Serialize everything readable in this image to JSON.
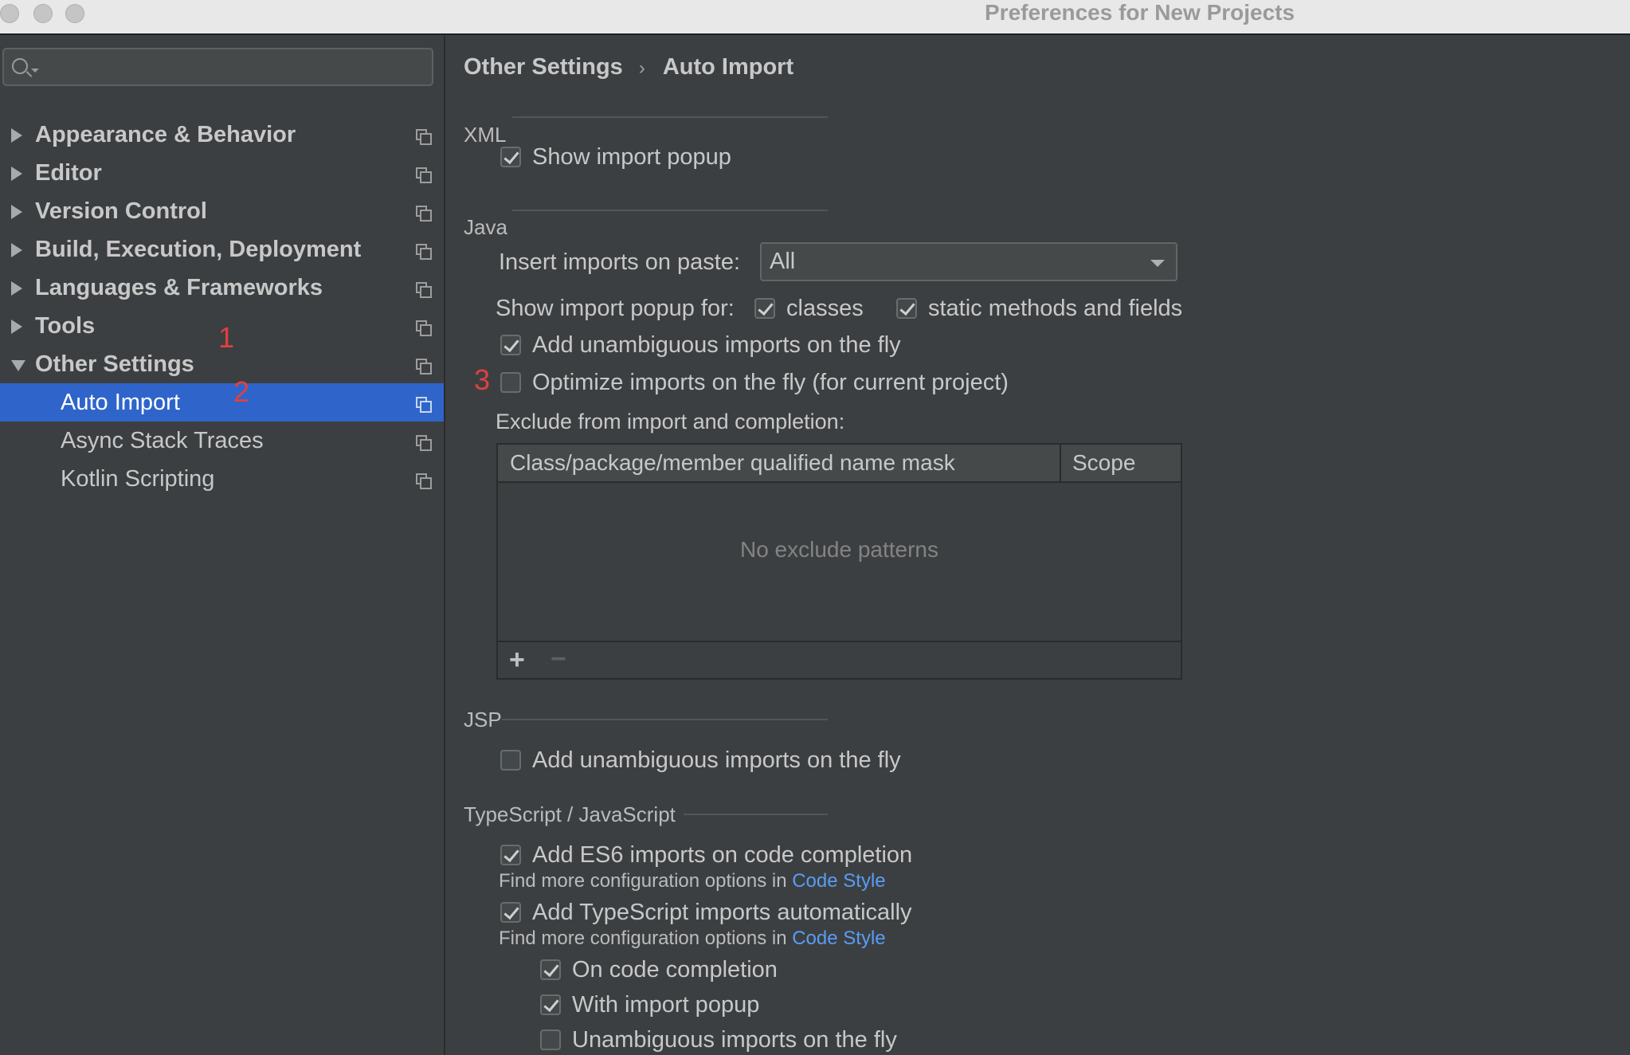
{
  "window": {
    "title": "Preferences for New Projects"
  },
  "sidebar": {
    "search": {
      "value": "",
      "placeholder": ""
    },
    "items": [
      {
        "label": "Appearance & Behavior"
      },
      {
        "label": "Editor"
      },
      {
        "label": "Version Control"
      },
      {
        "label": "Build, Execution, Deployment"
      },
      {
        "label": "Languages & Frameworks"
      },
      {
        "label": "Tools"
      },
      {
        "label": "Other Settings",
        "expanded": true
      },
      {
        "label": "Auto Import",
        "selected": true
      },
      {
        "label": "Async Stack Traces"
      },
      {
        "label": "Kotlin Scripting"
      }
    ]
  },
  "annotations": [
    "1",
    "2",
    "3"
  ],
  "breadcrumb": {
    "parent": "Other Settings",
    "separator": "›",
    "current": "Auto Import"
  },
  "xml": {
    "title": "XML",
    "show_import_popup": {
      "label": "Show import popup",
      "checked": true
    }
  },
  "java": {
    "title": "Java",
    "insert_on_paste_label": "Insert imports on paste:",
    "insert_on_paste_value": "All",
    "popup_for_label": "Show import popup for:",
    "classes": {
      "label": "classes",
      "checked": true
    },
    "static_methods": {
      "label": "static methods and fields",
      "checked": true
    },
    "unambiguous": {
      "label": "Add unambiguous imports on the fly",
      "checked": true
    },
    "optimize": {
      "label": "Optimize imports on the fly (for current project)",
      "checked": false
    },
    "exclude_label": "Exclude from import and completion:",
    "table": {
      "columns": [
        "Class/package/member qualified name mask",
        "Scope"
      ],
      "empty_text": "No exclude patterns",
      "add": "+",
      "remove": "−"
    }
  },
  "jsp": {
    "title": "JSP",
    "unambiguous": {
      "label": "Add unambiguous imports on the fly",
      "checked": false
    }
  },
  "ts": {
    "title": "TypeScript / JavaScript",
    "es6": {
      "label": "Add ES6 imports on code completion",
      "checked": true
    },
    "hint_prefix": "Find more configuration options in",
    "hint_link": "Code Style",
    "ts_auto": {
      "label": "Add TypeScript imports automatically",
      "checked": true
    },
    "on_completion": {
      "label": "On code completion",
      "checked": true
    },
    "with_popup": {
      "label": "With import popup",
      "checked": true
    },
    "unambiguous": {
      "label": "Unambiguous imports on the fly",
      "checked": false
    }
  },
  "colors": {
    "background": "#3c3f41",
    "selection": "#2f65ca",
    "link": "#589df6",
    "annotation": "#e04040"
  }
}
